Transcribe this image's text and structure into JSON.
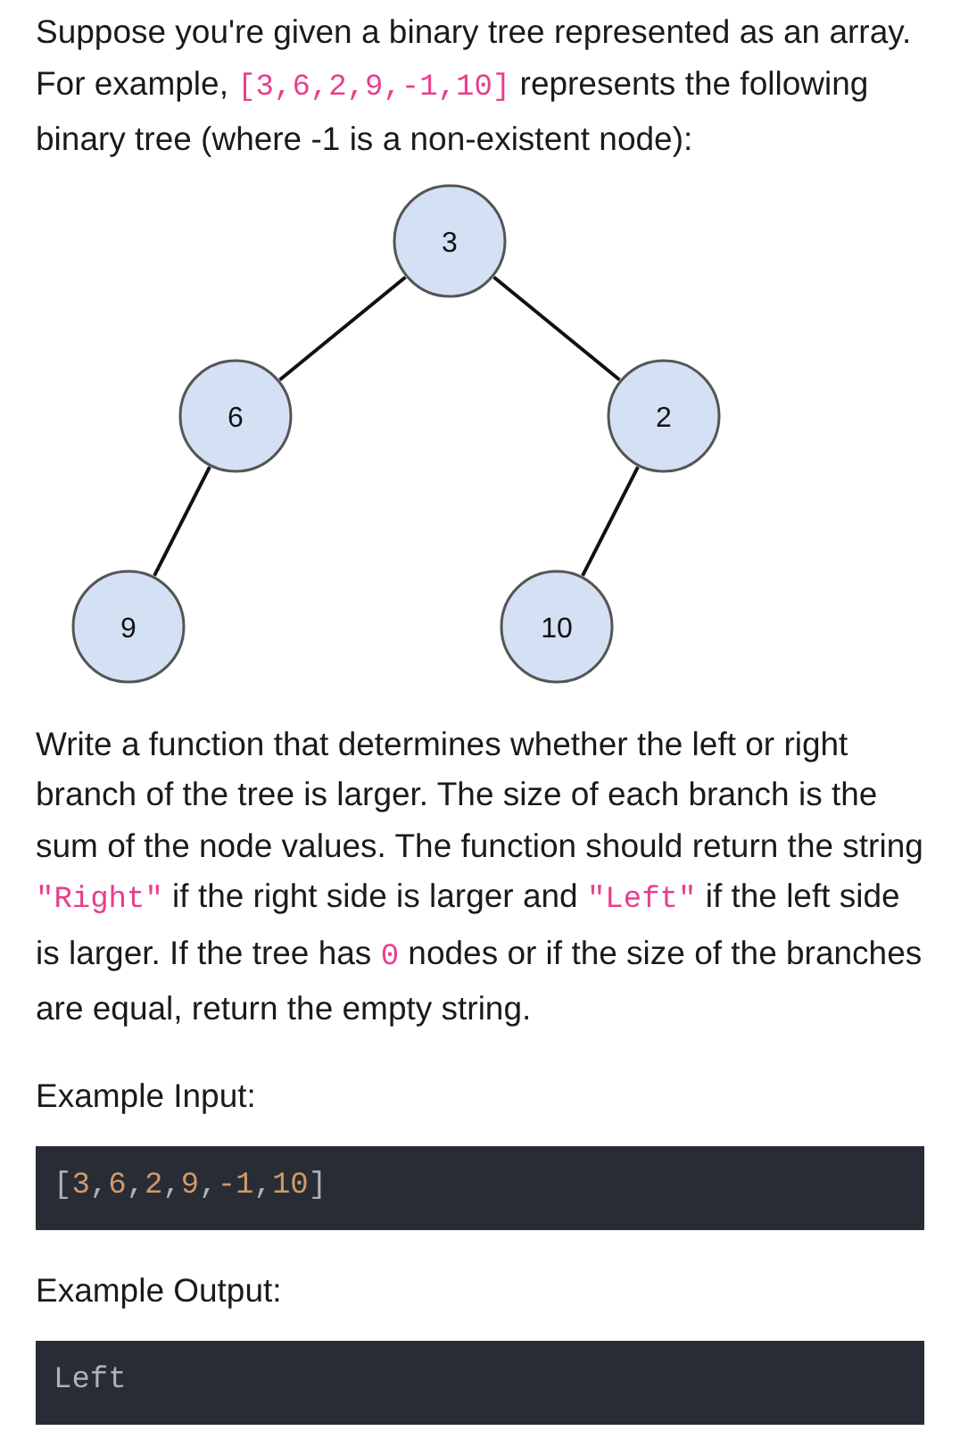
{
  "intro": [
    {
      "kind": "text",
      "text": "Suppose you're given a binary tree represented as an array. For example, "
    },
    {
      "kind": "code",
      "text": "[3,6,2,9,-1,10]"
    },
    {
      "kind": "text",
      "text": " represents the following binary tree (where -1 is a non-existent node):"
    }
  ],
  "tree": {
    "value": "3",
    "children": [
      {
        "value": "6",
        "children": [
          {
            "value": "9"
          }
        ]
      },
      {
        "value": "2",
        "children": [
          {
            "value": "10"
          }
        ]
      }
    ]
  },
  "task": [
    {
      "kind": "text",
      "text": "Write a function that determines whether the left or right branch of the tree is larger. The size of each branch is the sum of the node values. The function should return the string "
    },
    {
      "kind": "code",
      "text": "\"Right\""
    },
    {
      "kind": "text",
      "text": " if the right side is larger and "
    },
    {
      "kind": "code",
      "text": "\"Left\""
    },
    {
      "kind": "text",
      "text": " if the left side is larger. If the tree has "
    },
    {
      "kind": "code",
      "text": "0"
    },
    {
      "kind": "text",
      "text": " nodes or if the size of the branches are equal, return the empty string."
    }
  ],
  "examples": [
    {
      "label": "Example Input:",
      "code": [
        {
          "kind": "punct",
          "text": "["
        },
        {
          "kind": "number",
          "text": "3"
        },
        {
          "kind": "punct",
          "text": ","
        },
        {
          "kind": "number",
          "text": "6"
        },
        {
          "kind": "punct",
          "text": ","
        },
        {
          "kind": "number",
          "text": "2"
        },
        {
          "kind": "punct",
          "text": ","
        },
        {
          "kind": "number",
          "text": "9"
        },
        {
          "kind": "punct",
          "text": ","
        },
        {
          "kind": "number",
          "text": "-1"
        },
        {
          "kind": "punct",
          "text": ","
        },
        {
          "kind": "number",
          "text": "10"
        },
        {
          "kind": "punct",
          "text": "]"
        }
      ]
    },
    {
      "label": "Example Output:",
      "code": [
        {
          "kind": "plain",
          "text": "Left"
        }
      ]
    }
  ]
}
